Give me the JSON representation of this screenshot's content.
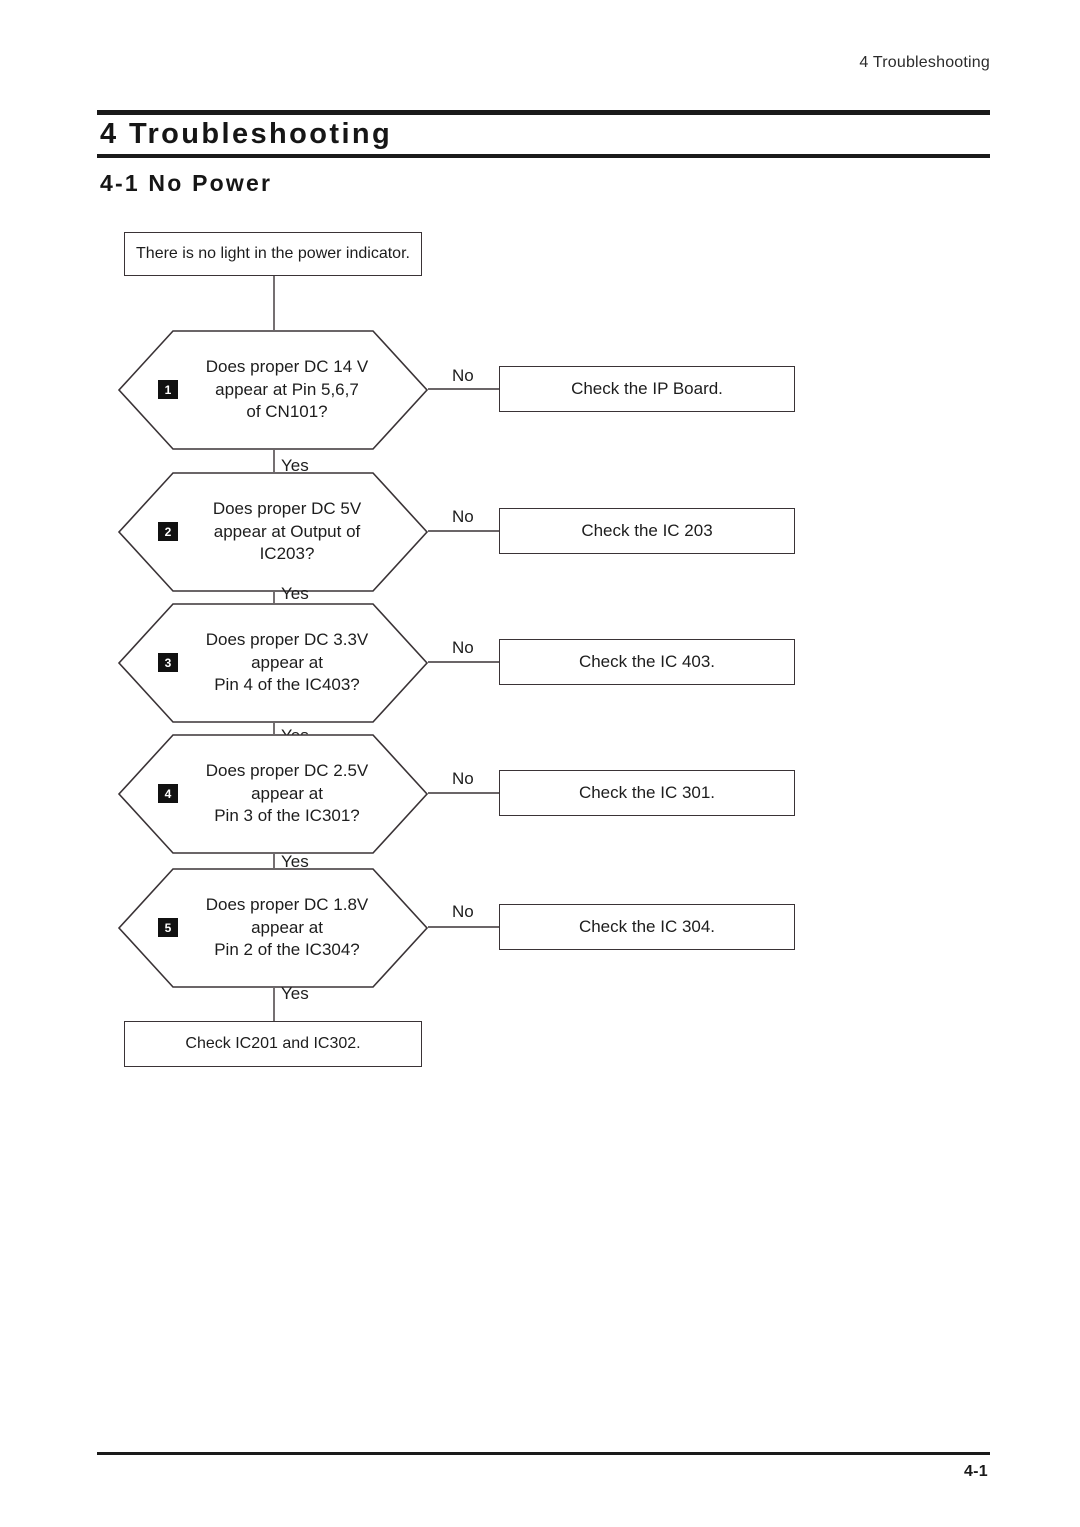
{
  "header": {
    "running_head": "4 Troubleshooting"
  },
  "chapter": {
    "title": "4 Troubleshooting",
    "section_title": "4-1 No Power"
  },
  "footer": {
    "page_number": "4-1"
  },
  "flowchart": {
    "start_box": "There is no light in the power indicator.",
    "end_box": "Check IC201 and IC302.",
    "yes_label": "Yes",
    "no_label": "No",
    "steps": [
      {
        "badge": "1",
        "question_line1": "Does proper DC 14 V",
        "question_line2": "appear at Pin 5,6,7",
        "question_line3": "of CN101?",
        "no_action": "Check the IP Board.",
        "yes_label": "Yes",
        "no_label": "No"
      },
      {
        "badge": "2",
        "question_line1": "Does proper DC 5V",
        "question_line2": "appear at Output of",
        "question_line3": "IC203?",
        "no_action": "Check the IC 203",
        "yes_label": "Yes",
        "no_label": "No"
      },
      {
        "badge": "3",
        "question_line1": "Does proper DC 3.3V",
        "question_line2": "appear at",
        "question_line3": "Pin 4 of the IC403?",
        "no_action": "Check the IC 403.",
        "yes_label": "Yes",
        "no_label": "No"
      },
      {
        "badge": "4",
        "question_line1": "Does proper DC 2.5V",
        "question_line2": "appear at",
        "question_line3": "Pin 3 of the IC301?",
        "no_action": "Check the IC 301.",
        "yes_label": "Yes",
        "no_label": "No"
      },
      {
        "badge": "5",
        "question_line1": "Does proper DC 1.8V",
        "question_line2": "appear at",
        "question_line3": "Pin 2 of the IC304?",
        "no_action": "Check the IC 304.",
        "yes_label": "Yes",
        "no_label": "No"
      }
    ]
  },
  "colors": {
    "ink": "#1a1a1a",
    "stroke": "#3a3336",
    "badge_bg": "#111111",
    "badge_fg": "#ffffff",
    "paper": "#ffffff"
  }
}
